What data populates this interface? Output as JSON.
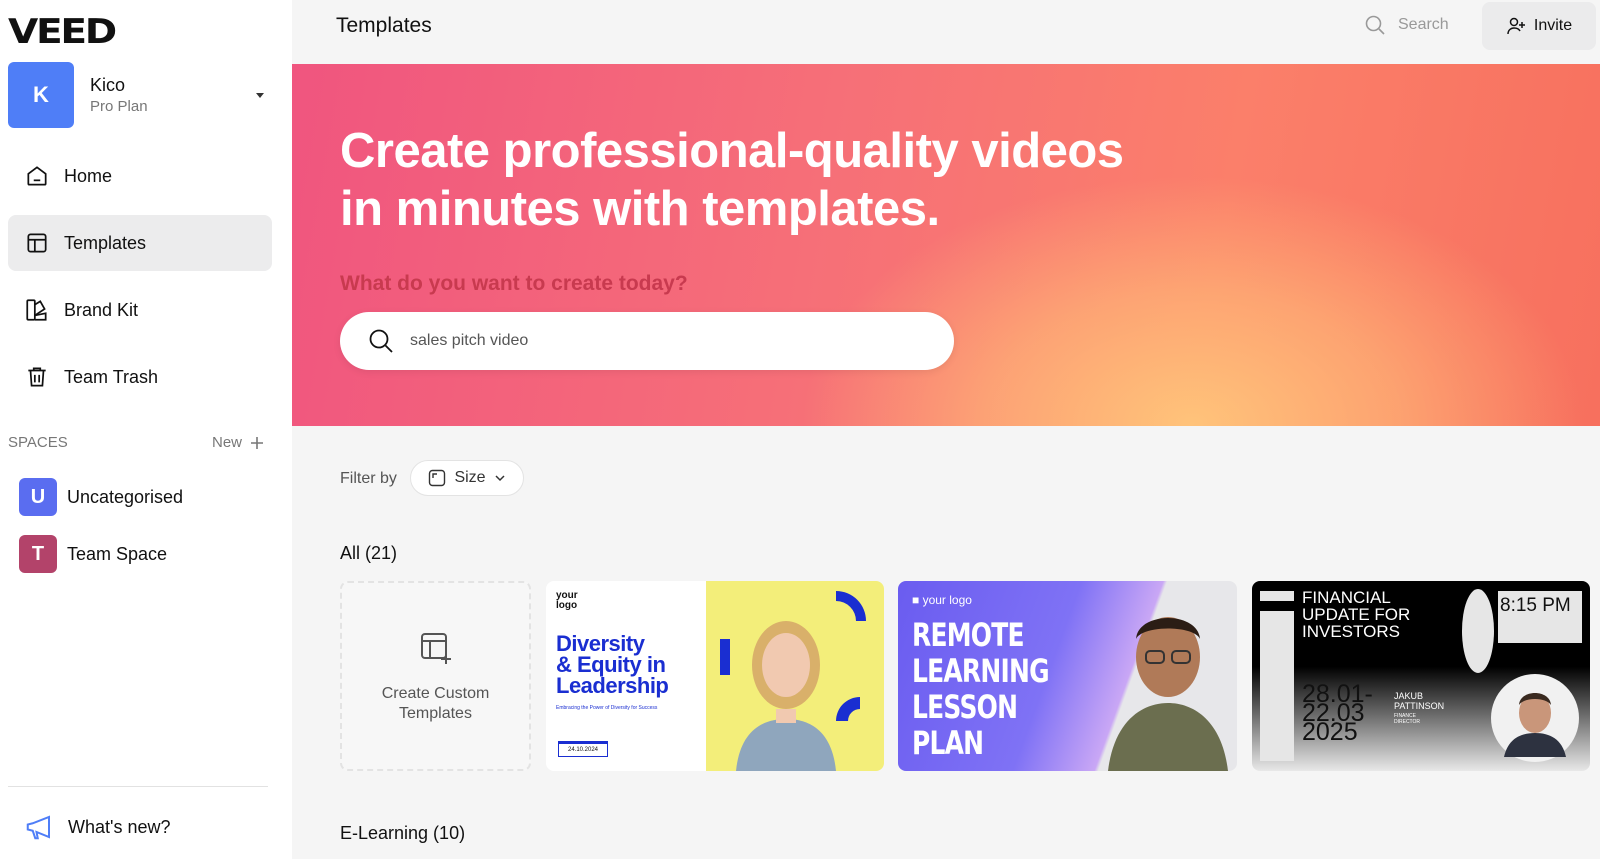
{
  "sidebar": {
    "logo": "VEED",
    "account": {
      "initial": "K",
      "name": "Kico",
      "plan": "Pro Plan"
    },
    "nav": [
      {
        "label": "Home",
        "icon": "home-icon"
      },
      {
        "label": "Templates",
        "icon": "templates-icon",
        "active": true
      },
      {
        "label": "Brand Kit",
        "icon": "brand-kit-icon"
      },
      {
        "label": "Team Trash",
        "icon": "trash-icon"
      }
    ],
    "spaces_label": "SPACES",
    "new_label": "New",
    "spaces": [
      {
        "initial": "U",
        "name": "Uncategorised",
        "color": "#5a6df0"
      },
      {
        "initial": "T",
        "name": "Team Space",
        "color": "#b3436a"
      }
    ],
    "whats_new": "What's new?"
  },
  "topbar": {
    "title": "Templates",
    "search_label": "Search",
    "invite_label": "Invite"
  },
  "hero": {
    "title_line1": "Create professional-quality videos",
    "title_line2": "in minutes with templates.",
    "question": "What do you want to create today?",
    "search_value": "sales pitch video"
  },
  "filter": {
    "label": "Filter by",
    "size_label": "Size"
  },
  "sections": {
    "all_title": "All (21)",
    "elearning_title": "E-Learning (10)"
  },
  "create_card": {
    "label_line1": "Create Custom",
    "label_line2": "Templates"
  },
  "templates": [
    {
      "logo_line1": "your",
      "logo_line2": "logo",
      "headline_line1": "Diversity",
      "headline_line2": "& Equity in",
      "headline_line3": "Leadership",
      "subtitle": "Embracing the Power of Diversity for Success",
      "date": "24.10.2024"
    },
    {
      "logo": "■ your logo",
      "headline_line1": "REMOTE",
      "headline_line2": "LEARNING",
      "headline_line3": "LESSON",
      "headline_line4": "PLAN"
    },
    {
      "headline_line1": "FINANCIAL",
      "headline_line2": "UPDATE FOR",
      "headline_line3": "INVESTORS",
      "time": "8:15 PM",
      "date_line1": "28.01-",
      "date_line2": "22.03",
      "date_line3": "2025",
      "name_line1": "JAKUB",
      "name_line2": "PATTINSON",
      "role_line1": "FINANCE",
      "role_line2": "DIRECTOR"
    }
  ],
  "colors": {
    "accent": "#4f7ef7",
    "hero_text": "#c83a4f",
    "active_nav": "#ececed"
  }
}
